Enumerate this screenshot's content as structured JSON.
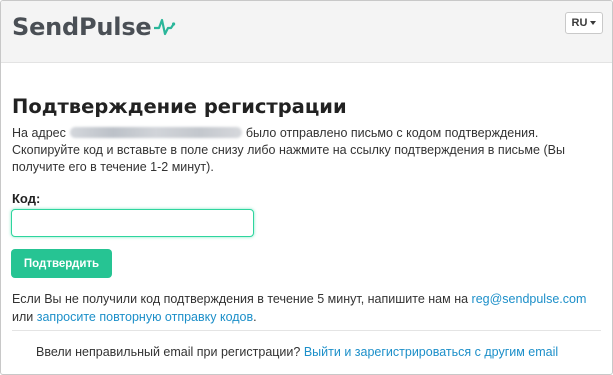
{
  "header": {
    "logo_text": "SendPulse",
    "logo_icon": "pulse-wave-icon",
    "language_label": "RU"
  },
  "main": {
    "title": "Подтверждение регистрации",
    "desc_before_email": "На адрес",
    "desc_after_email": "было отправлено письмо с кодом подтверждения. Скопируйте код и вставьте в поле снизу либо нажмите на ссылку подтверждения в письме (Вы получите его в течение 1-2 минут).",
    "code_label": "Код:",
    "code_value": "",
    "confirm_button": "Подтвердить",
    "help_text": "Если Вы не получили код подтверждения в течение 5 минут, напишите нам на",
    "help_email": "reg@sendpulse.com",
    "help_or": "или",
    "resend_link": "запросите повторную отправку кодов",
    "help_end": "."
  },
  "footer": {
    "question": "Ввели неправильный email при регистрации?",
    "link": "Выйти и зарегистрироваться с другим email"
  },
  "colors": {
    "accent": "#26c493",
    "link": "#1c8fc9",
    "logo": "#4a4f55"
  }
}
